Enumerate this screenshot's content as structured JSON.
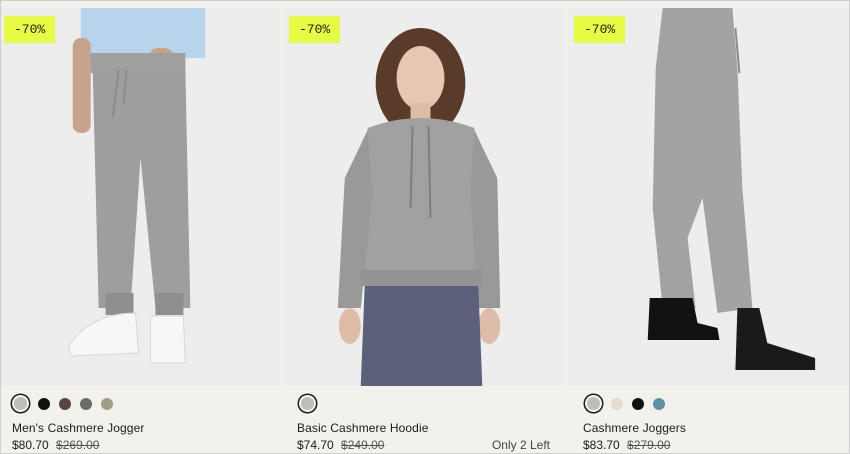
{
  "products": [
    {
      "badge": "-70%",
      "name": "Men's Cashmere Jogger",
      "price": "$80.70",
      "original_price": "$269.00",
      "stock_note": "",
      "swatches": [
        {
          "color": "#bdbdbd",
          "selected": true
        },
        {
          "color": "#111111",
          "selected": false
        },
        {
          "color": "#5a4440",
          "selected": false
        },
        {
          "color": "#6b6b6b",
          "selected": false
        },
        {
          "color": "#a49c8a",
          "selected": false
        }
      ]
    },
    {
      "badge": "-70%",
      "name": "Basic Cashmere Hoodie",
      "price": "$74.70",
      "original_price": "$249.00",
      "stock_note": "Only 2 Left",
      "swatches": [
        {
          "color": "#bdbdbd",
          "selected": true
        }
      ]
    },
    {
      "badge": "-70%",
      "name": "Cashmere Joggers",
      "price": "$83.70",
      "original_price": "$279.00",
      "stock_note": "",
      "swatches": [
        {
          "color": "#bdbdbd",
          "selected": true
        },
        {
          "color": "#e6ddcf",
          "selected": false
        },
        {
          "color": "#111111",
          "selected": false
        },
        {
          "color": "#5c93a3",
          "selected": false
        }
      ]
    }
  ],
  "colors": {
    "badge_bg": "#e6fb43",
    "page_bg": "#f3f1ec",
    "photo_bg": "#ededed"
  }
}
